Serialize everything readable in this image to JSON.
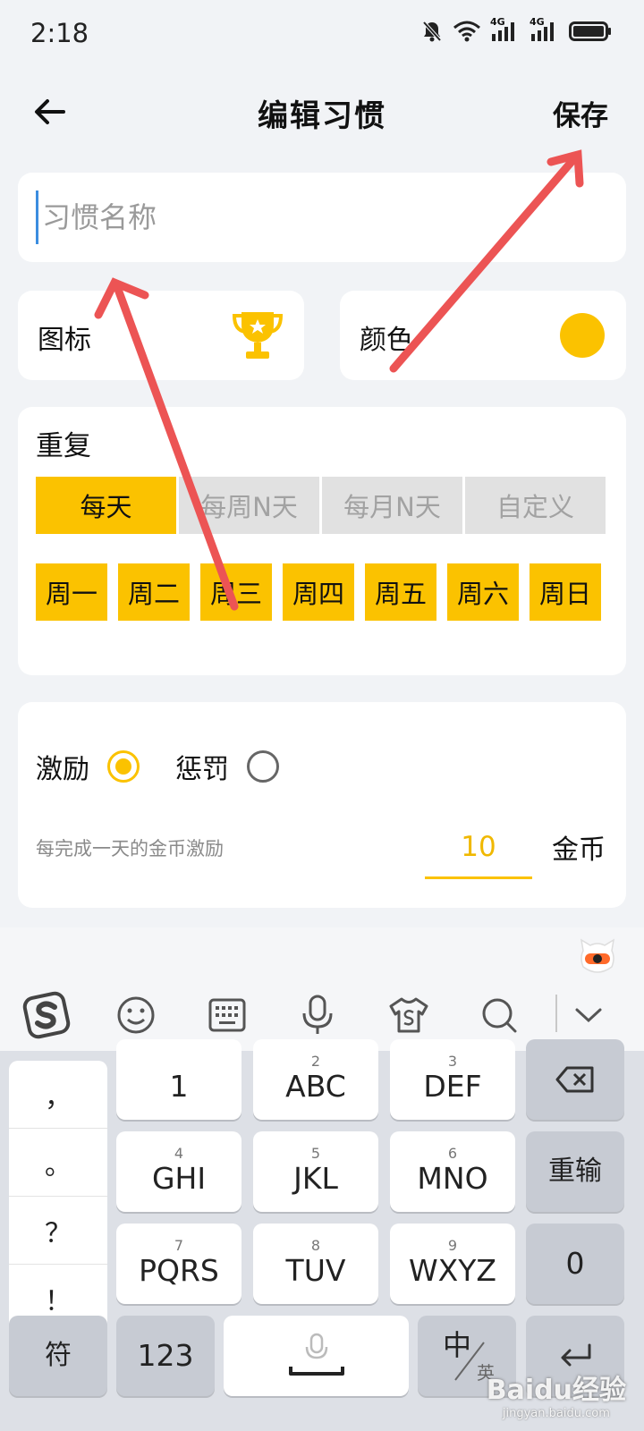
{
  "status_bar": {
    "time": "2:18",
    "network_1": "4G",
    "network_2": "4G"
  },
  "header": {
    "title": "编辑习惯",
    "save_label": "保存"
  },
  "habit_name": {
    "placeholder": "习惯名称",
    "value": ""
  },
  "icon_field": {
    "label": "图标",
    "icon": "trophy-icon"
  },
  "color_field": {
    "label": "颜色",
    "color": "#fbc200"
  },
  "repeat": {
    "title": "重复",
    "modes": [
      "每天",
      "每周N天",
      "每月N天",
      "自定义"
    ],
    "selected_mode": "每天",
    "days": [
      "周一",
      "周二",
      "周三",
      "周四",
      "周五",
      "周六",
      "周日"
    ]
  },
  "reward": {
    "incentive_label": "激励",
    "penalty_label": "惩罚",
    "selected": "激励",
    "description": "每完成一天的金币激励",
    "amount": "10",
    "unit": "金币"
  },
  "keyboard": {
    "toolbar": [
      "sogou-logo-icon",
      "emoji-icon",
      "keyboard-icon",
      "microphone-icon",
      "skin-icon",
      "search-icon",
      "chevron-down-icon"
    ],
    "punctuation": [
      "，",
      "。",
      "？",
      "！"
    ],
    "keys": [
      {
        "num": "",
        "label": "1"
      },
      {
        "num": "2",
        "label": "ABC"
      },
      {
        "num": "3",
        "label": "DEF"
      },
      {
        "num": "4",
        "label": "GHI"
      },
      {
        "num": "5",
        "label": "JKL"
      },
      {
        "num": "6",
        "label": "MNO"
      },
      {
        "num": "7",
        "label": "PQRS"
      },
      {
        "num": "8",
        "label": "TUV"
      },
      {
        "num": "9",
        "label": "WXYZ"
      }
    ],
    "delete": "backspace-icon",
    "reenter": "重输",
    "zero": "0",
    "symbols": "符",
    "numbers": "123",
    "lang_main": "中",
    "lang_alt": "英"
  },
  "watermark": {
    "text": "Baidu经验",
    "url": "jingyan.baidu.com"
  },
  "colors": {
    "accent": "#fbc200",
    "arrow": "#ec5454"
  }
}
